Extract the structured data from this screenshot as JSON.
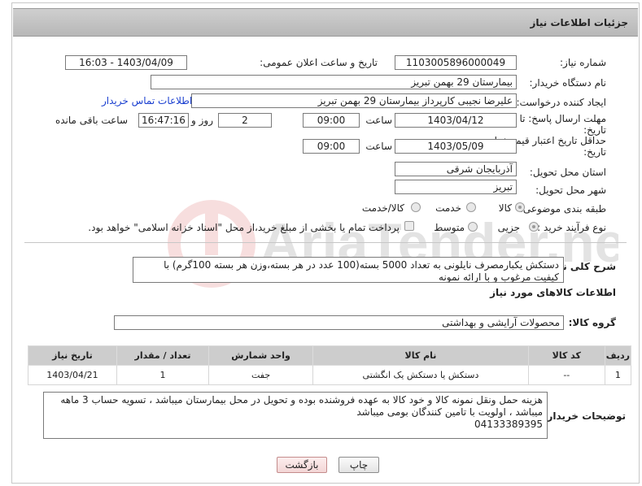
{
  "header": {
    "title": "جزئیات اطلاعات نیاز"
  },
  "fields": {
    "need_number_label": "شماره نیاز:",
    "need_number": "1103005896000049",
    "announce_label": "تاریخ و ساعت اعلان عمومی:",
    "announce_value": "1403/04/09 - 16:03",
    "buyer_org_label": "نام دستگاه خریدار:",
    "buyer_org": "بیمارستان 29 بهمن تبریز",
    "requester_label": "ایجاد کننده درخواست:",
    "requester": "علیرضا نجیبی کارپرداز بیمارستان 29 بهمن تبریز",
    "contact_link": "اطلاعات تماس خریدار",
    "reply_deadline_label_1": "مهلت ارسال پاسخ: تا",
    "reply_deadline_label_2": "تاریخ:",
    "reply_date": "1403/04/12",
    "time_label": "ساعت",
    "reply_time": "09:00",
    "days_value": "2",
    "days_label": "روز و",
    "remaining_time": "16:47:16",
    "remaining_label": "ساعت باقی مانده",
    "validity_label_1": "حداقل تاریخ اعتبار قیمت: تا",
    "validity_label_2": "تاریخ:",
    "validity_date": "1403/05/09",
    "validity_time": "09:00",
    "province_label": "استان محل تحویل:",
    "province": "آذربایجان شرقی",
    "city_label": "شهر محل تحویل:",
    "city": "تبریز",
    "category_label": "طبقه بندی موضوعی:",
    "category_options": [
      "کالا",
      "خدمت",
      "کالا/خدمت"
    ],
    "process_label": "نوع فرآیند خرید :",
    "process_options": [
      "جزیی",
      "متوسط"
    ],
    "payment_note": "پرداخت تمام یا بخشی از مبلغ خرید،از محل \"اسناد خزانه اسلامی\" خواهد بود."
  },
  "description": {
    "label": "شرح کلی نیاز:",
    "text": "دستکش یکبارمصرف نایلونی به تعداد 5000 بسته(100 عدد در هر بسته،وزن هر بسته 100گرم) با کیفیت مرغوب و با ارائه نمونه"
  },
  "goods_section": {
    "title": "اطلاعات کالاهای مورد نیاز",
    "group_label": "گروه کالا:",
    "group_value": "محصولات آرایشی و بهداشتی"
  },
  "table": {
    "headers": [
      "ردیف",
      "کد کالا",
      "نام کالا",
      "واحد شمارش",
      "تعداد / مقدار",
      "تاریخ نیاز"
    ],
    "rows": [
      [
        "1",
        "--",
        "دستکش یا دستکش یک انگشتی",
        "جفت",
        "1",
        "1403/04/21"
      ]
    ]
  },
  "buyer_notes": {
    "label": "توضیحات خریدار:",
    "text": "هزینه حمل ونقل نمونه کالا و خود کالا به عهده فروشنده بوده و تحویل در محل بیمارستان میباشد ، تسویه حساب 3 ماهه میباشد ، اولویت با تامین کنندگان بومی میباشد",
    "phone": "04133389395"
  },
  "buttons": {
    "print": "چاپ",
    "back": "بازگشت"
  },
  "watermark": "AriaTender.neT"
}
